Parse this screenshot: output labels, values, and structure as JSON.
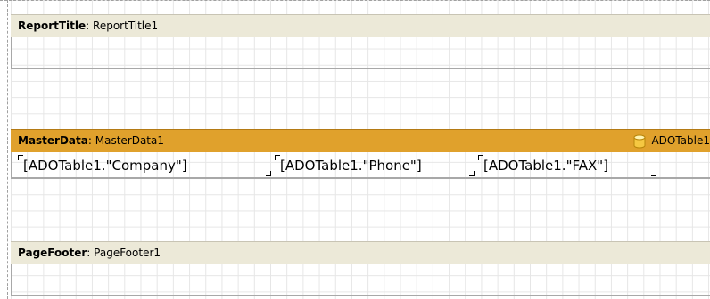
{
  "bands": {
    "report_title": {
      "type": "ReportTitle",
      "name": "ReportTitle1"
    },
    "master_data": {
      "type": "MasterData",
      "name": "MasterData1",
      "dataset": "ADOTable1"
    },
    "page_footer": {
      "type": "PageFooter",
      "name": "PageFooter1"
    }
  },
  "separator": ": ",
  "memos": {
    "company": "[ADOTable1.\"Company\"]",
    "phone": "[ADOTable1.\"Phone\"]",
    "fax": "[ADOTable1.\"FAX\"]"
  },
  "colors": {
    "band_header": "#ece9d8",
    "master_band_header": "#e0a12c",
    "grid_line": "#e6e6e6"
  },
  "icons": {
    "dataset": "database-icon"
  }
}
